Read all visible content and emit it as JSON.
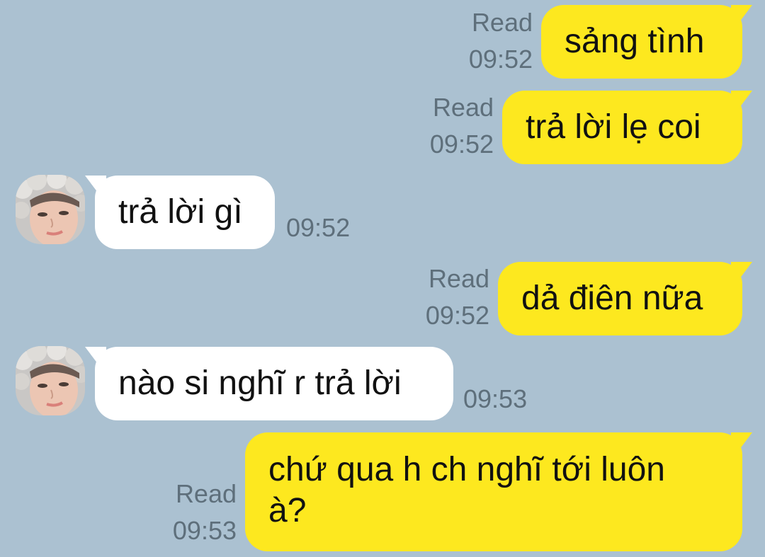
{
  "messages": [
    {
      "direction": "out",
      "text": "sảng tình",
      "status": "Read",
      "time": "09:52"
    },
    {
      "direction": "out",
      "text": "trả lời lẹ coi",
      "status": "Read",
      "time": "09:52"
    },
    {
      "direction": "in",
      "text": "trả lời gì",
      "time": "09:52",
      "avatar_icon": "contact-photo"
    },
    {
      "direction": "out",
      "text": "dả điên nữa",
      "status": "Read",
      "time": "09:52"
    },
    {
      "direction": "in",
      "text": "nào si nghĩ r trả lời",
      "time": "09:53",
      "avatar_icon": "contact-photo"
    },
    {
      "direction": "out",
      "text_lines": [
        "chứ qua h ch nghĩ tới luôn",
        "à?"
      ],
      "status": "Read",
      "time": "09:53"
    }
  ],
  "colors": {
    "background": "#abc1d1",
    "outgoing_bubble": "#fde81f",
    "incoming_bubble": "#ffffff",
    "meta_text": "#5e6f7b"
  }
}
